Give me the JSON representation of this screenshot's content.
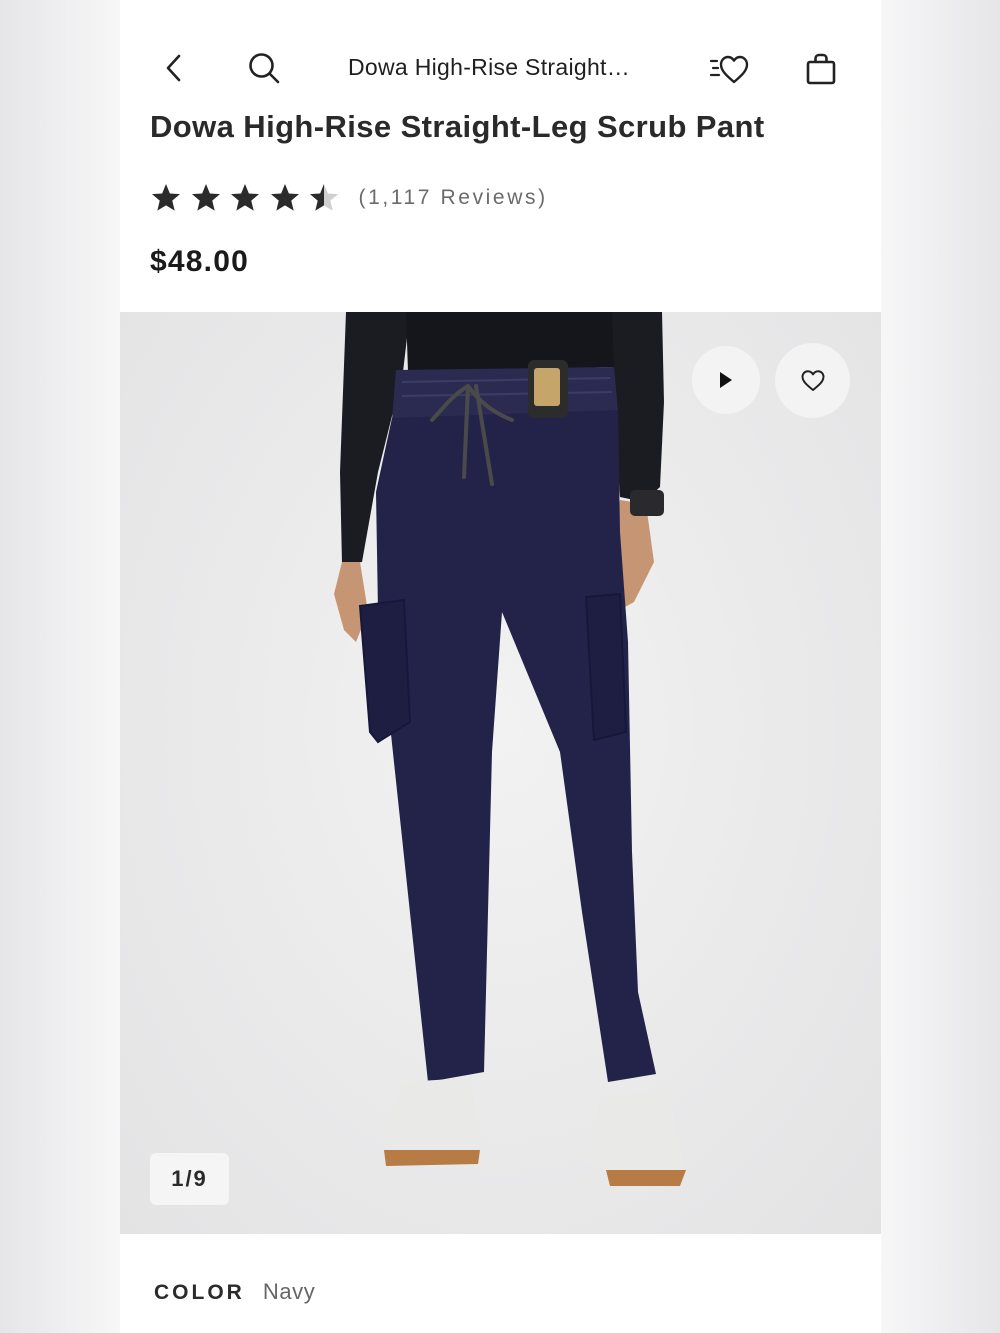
{
  "nav": {
    "title": "Dowa High-Rise Straight…"
  },
  "product": {
    "title": "Dowa High-Rise Straight-Leg Scrub Pant",
    "rating": 4.5,
    "rating_max": 5,
    "reviews_label": "(1,117 Reviews)",
    "price": "$48.00"
  },
  "gallery": {
    "counter": "1/9"
  },
  "color": {
    "label": "COLOR",
    "value": "Navy"
  },
  "icons": [
    "back-chevron-icon",
    "search-icon",
    "wishlist-heart-icon",
    "shopping-bag-icon",
    "star-icon",
    "play-icon",
    "heart-icon"
  ],
  "colors": {
    "star": "#2b2b2b",
    "star_empty": "#c9c9c9",
    "pants": "#23234a",
    "top": "#1b1c22"
  }
}
